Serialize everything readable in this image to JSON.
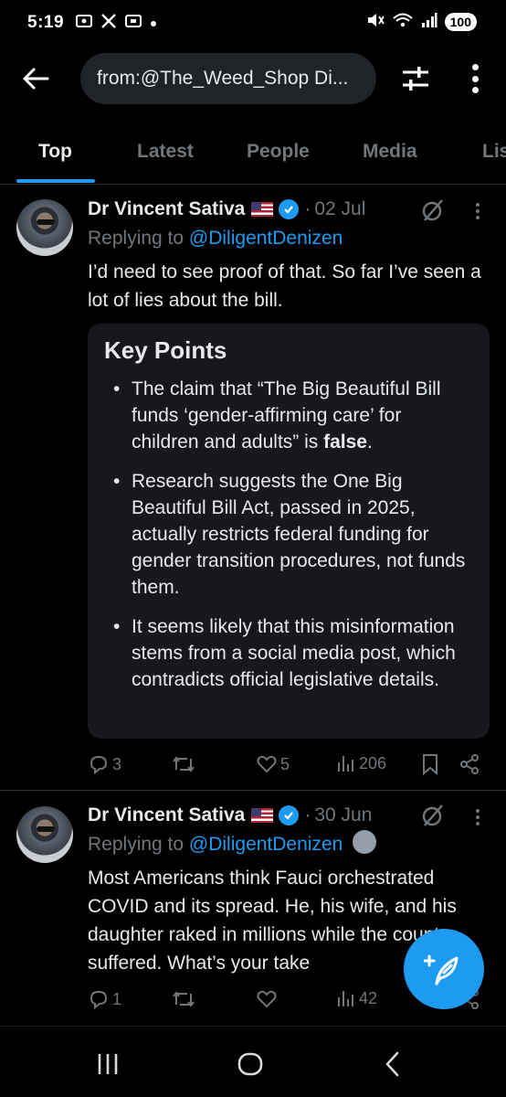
{
  "status_bar": {
    "time": "5:19",
    "left_icons": [
      "screen-cast-icon",
      "x-logo-icon",
      "screen-cast-icon",
      "dot"
    ],
    "right_icons": [
      "mute-icon",
      "wifi-6e-icon",
      "signal-icon"
    ],
    "battery": "100"
  },
  "search": {
    "query": "from:@The_Weed_Shop Di..."
  },
  "tabs": [
    {
      "label": "Top",
      "active": true
    },
    {
      "label": "Latest",
      "active": false
    },
    {
      "label": "People",
      "active": false
    },
    {
      "label": "Media",
      "active": false
    },
    {
      "label": "Lis",
      "active": false
    }
  ],
  "tweets": [
    {
      "author": "Dr Vincent Sativa",
      "dot": "·",
      "date": "02 Jul",
      "replying_prefix": "Replying to",
      "replying_handle": "@DiligentDenizen",
      "text": "I’d need to see proof of that. So far I’ve seen a lot of lies about the bill.",
      "card": {
        "title": "Key Points",
        "items": [
          {
            "text": "The claim that “The Big Beautiful Bill funds ‘gender-affirming care’ for children and adults” is ",
            "bold": "false",
            "end": "."
          },
          {
            "text": "Research suggests the One Big Beautiful Bill Act, passed in 2025, actually restricts federal funding for gender transition procedures, not funds them.",
            "bold": "",
            "end": ""
          },
          {
            "text": "It seems likely that this misinformation stems from a social media post, which contradicts official legislative details.",
            "bold": "",
            "end": ""
          }
        ]
      },
      "stats": {
        "replies": "3",
        "reposts": "",
        "likes": "5",
        "views": "206"
      }
    },
    {
      "author": "Dr Vincent Sativa",
      "dot": "·",
      "date": "30 Jun",
      "replying_prefix": "Replying to",
      "replying_handle": "@DiligentDenizen",
      "text": "Most Americans think Fauci orchestrated COVID and its spread. He, his wife, and his daughter raked in millions while the country suffered. What’s your take",
      "stats": {
        "replies": "1",
        "reposts": "",
        "likes": "",
        "views": "42"
      }
    }
  ],
  "colors": {
    "background": "#000000",
    "accent": "#1d9bf0",
    "text_primary": "#e7e9ea",
    "text_secondary": "#71767b",
    "card_bg": "#16181c"
  }
}
